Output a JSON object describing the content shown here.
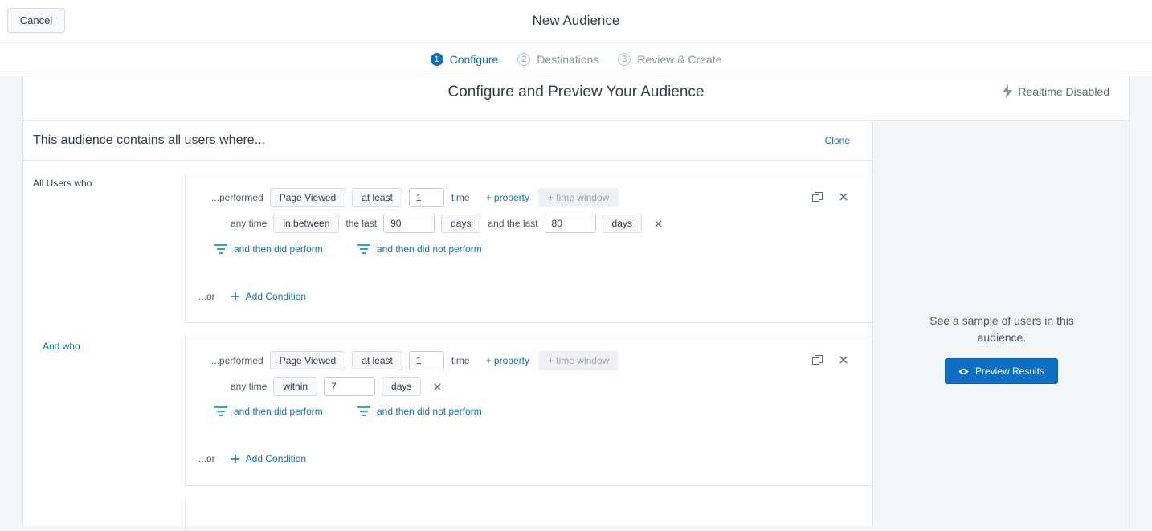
{
  "header": {
    "cancel_label": "Cancel",
    "title": "New Audience"
  },
  "steps": [
    {
      "num": "1",
      "label": "Configure"
    },
    {
      "num": "2",
      "label": "Destinations"
    },
    {
      "num": "3",
      "label": "Review & Create"
    }
  ],
  "card": {
    "title": "Configure and Preview Your Audience",
    "realtime_label": "Realtime Disabled"
  },
  "builder": {
    "title": "This audience contains all users where...",
    "clone_label": "Clone",
    "groups": [
      {
        "label": "All Users who",
        "performed_label": "...performed",
        "event": "Page Viewed",
        "operator": "at least",
        "count": "1",
        "count_unit": "time",
        "property_link": "+ property",
        "time_window": "+ time window",
        "time_label": "any time",
        "time_mode": "in between",
        "last_label": "the last",
        "last_value": "90",
        "last_unit": "days",
        "and_last_label": "and the last",
        "and_last_value": "80",
        "and_last_unit": "days",
        "then_perform": "and then did perform",
        "then_not_perform": "and then did not perform",
        "or_label": "...or",
        "add_condition": "Add Condition"
      },
      {
        "label": "And who",
        "performed_label": "...performed",
        "event": "Page Viewed",
        "operator": "at least",
        "count": "1",
        "count_unit": "time",
        "property_link": "+ property",
        "time_window": "+ time window",
        "time_label": "any time",
        "time_mode": "within",
        "within_value": "7",
        "within_unit": "days",
        "then_perform": "and then did perform",
        "then_not_perform": "and then did not perform",
        "or_label": "...or",
        "add_condition": "Add Condition"
      }
    ]
  },
  "preview": {
    "text": "See a sample of users in this audience.",
    "button_label": "Preview Results"
  },
  "colors": {
    "accent": "#0d6fc4",
    "text": "#2f3d4c",
    "border": "#e4e7eb",
    "panel": "#f3f5f7"
  },
  "icons": [
    "lightning-icon",
    "duplicate-icon",
    "close-icon",
    "filter-funnel-icon",
    "plus-icon",
    "eye-icon"
  ]
}
